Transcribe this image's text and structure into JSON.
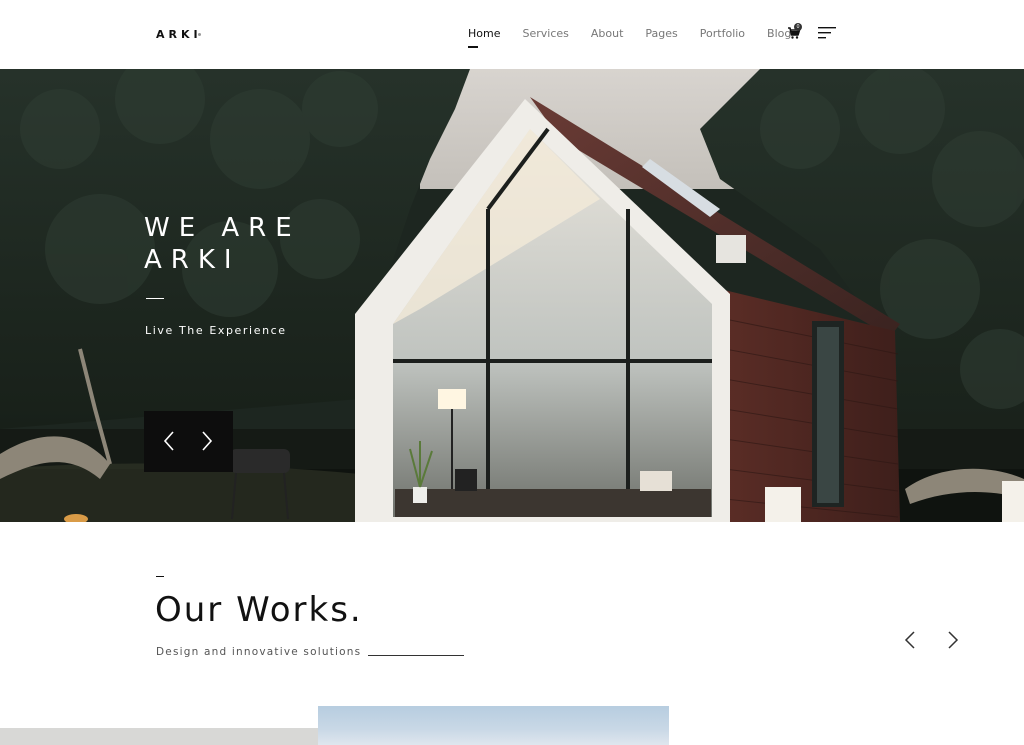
{
  "header": {
    "logo": "ARKI",
    "nav": [
      "Home",
      "Services",
      "About",
      "Pages",
      "Portfolio",
      "Blog"
    ],
    "active_nav": "Home",
    "cart_count": "0",
    "icons": [
      "cart-icon",
      "menu-icon"
    ]
  },
  "hero": {
    "title_line1": "WE ARE",
    "title_line2": "ARKI",
    "subtitle": "Live The Experience",
    "controls": [
      "chevron-left-icon",
      "chevron-right-icon"
    ]
  },
  "works": {
    "title": "Our Works.",
    "subtitle": "Design and innovative solutions",
    "controls": [
      "chevron-left-icon",
      "chevron-right-icon"
    ]
  },
  "colors": {
    "accent": "#111111",
    "muted": "#777777",
    "hero_forest": "#1d2620",
    "house_wall": "#5a2f28"
  }
}
